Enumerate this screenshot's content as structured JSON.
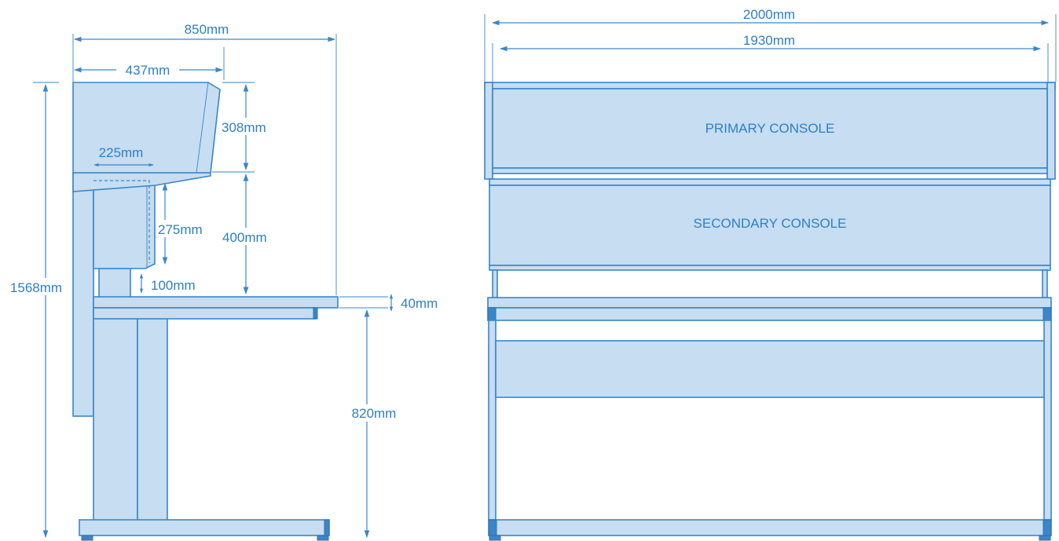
{
  "side_view": {
    "dims": {
      "total_depth": "850mm",
      "console_depth": "437mm",
      "screen_depth": "225mm",
      "total_height": "1568mm",
      "primary_height": "308mm",
      "secondary_height": "275mm",
      "upper_clearance": "400mm",
      "gap": "100mm",
      "desk_thickness": "40mm",
      "desk_height": "820mm"
    }
  },
  "front_view": {
    "dims": {
      "overall_width": "2000mm",
      "inner_width": "1930mm"
    },
    "labels": {
      "primary": "PRIMARY CONSOLE",
      "secondary": "SECONDARY CONSOLE"
    }
  },
  "colors": {
    "line": "#3a86c8",
    "fill": "#c6ddf2",
    "text": "#2f7fc4"
  }
}
